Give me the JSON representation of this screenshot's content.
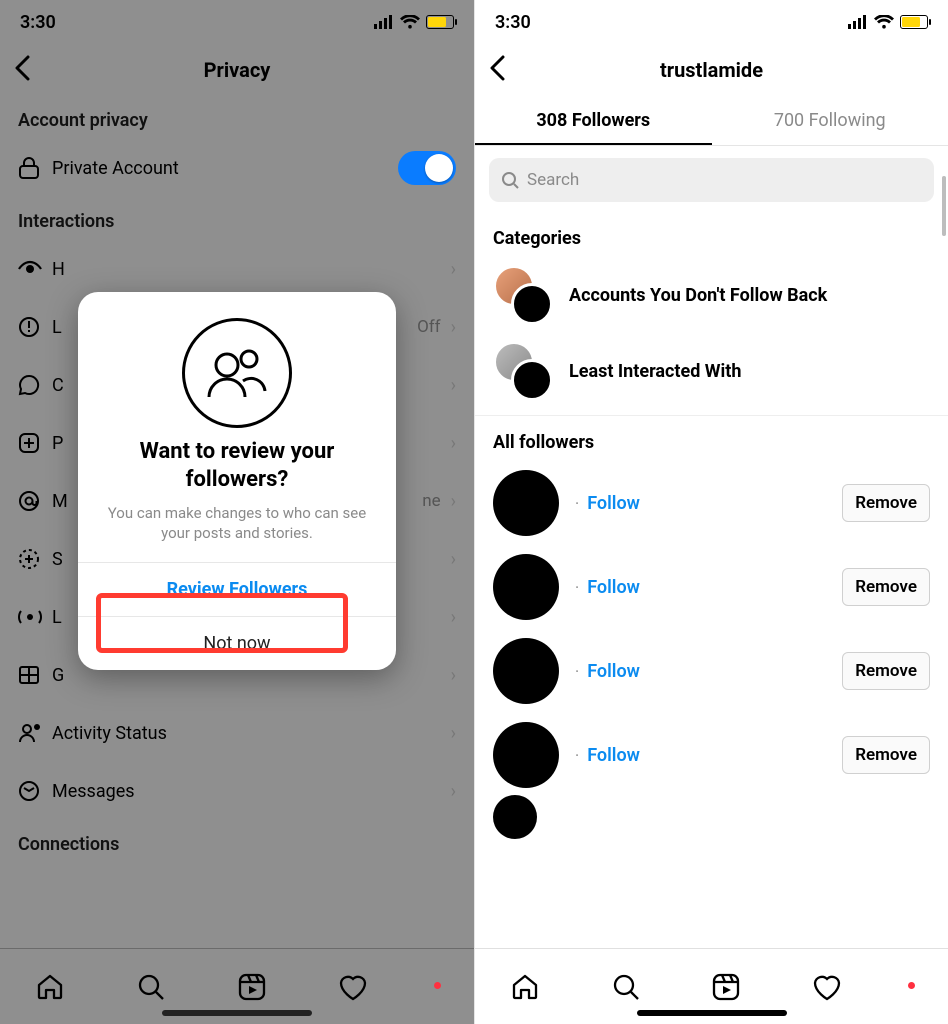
{
  "status": {
    "time": "3:30"
  },
  "left": {
    "header_title": "Privacy",
    "section_account": "Account privacy",
    "private_account": "Private Account",
    "section_interactions": "Interactions",
    "rows": {
      "h": "H",
      "l": "L",
      "l_meta": "Off",
      "c": "C",
      "p": "P",
      "m": "M",
      "m_meta": "ne",
      "s": "S",
      "l2": "L",
      "g": "G",
      "activity": "Activity Status",
      "messages": "Messages"
    },
    "section_connections": "Connections",
    "modal": {
      "title": "Want to review your followers?",
      "body": "You can make changes to who can see your posts and stories.",
      "primary": "Review Followers",
      "secondary": "Not now"
    }
  },
  "right": {
    "header_title": "trustlamide",
    "tab_followers": "308 Followers",
    "tab_following": "700 Following",
    "search_placeholder": "Search",
    "section_categories": "Categories",
    "cat1": "Accounts You Don't Follow Back",
    "cat2": "Least Interacted With",
    "section_all": "All followers",
    "follow": "Follow",
    "remove": "Remove"
  }
}
